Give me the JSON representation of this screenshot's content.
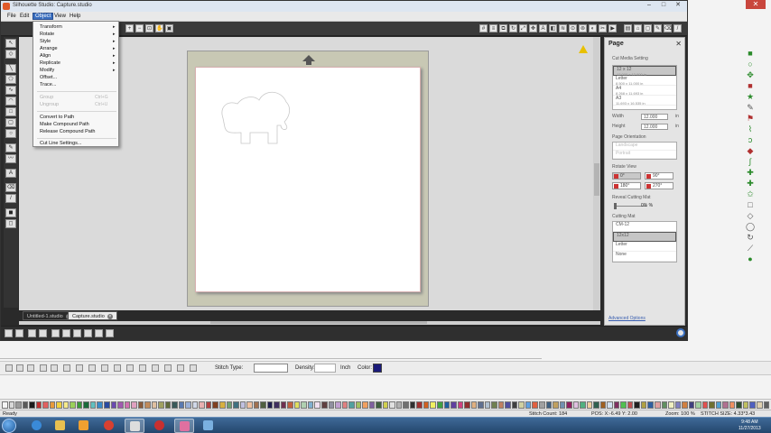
{
  "window": {
    "title": "Silhouette Studio: Capture.studio"
  },
  "menubar": {
    "file": "File",
    "edit": "Edit",
    "object": "Object",
    "view": "View",
    "help": "Help"
  },
  "object_menu": {
    "transform": "Transform",
    "rotate": "Rotate",
    "style": "Style",
    "arrange": "Arrange",
    "align": "Align",
    "replicate": "Replicate",
    "modify": "Modify",
    "offset": "Offset...",
    "trace": "Trace...",
    "group": "Group",
    "group_shortcut": "Ctrl+G",
    "ungroup": "Ungroup",
    "ungroup_shortcut": "Ctrl+U",
    "convert_to_path": "Convert to Path",
    "make_compound_path": "Make Compound Path",
    "release_compound_path": "Release Compound Path",
    "cut_line_settings": "Cut Line Settings..."
  },
  "doc_tabs": {
    "tab1": "Untitled-1.studio",
    "tab2": "Capture.studio"
  },
  "page_panel": {
    "title": "Page",
    "section_setting": "Cut Media Setting",
    "sizes": [
      {
        "name": "12 x 12",
        "dims": "12.000 x 12.000 in"
      },
      {
        "name": "Letter",
        "dims": "8.500 x 11.000 in"
      },
      {
        "name": "A4",
        "dims": "8.268 x 11.693 in"
      },
      {
        "name": "A3",
        "dims": "11.693 x 16.535 in"
      }
    ],
    "width_label": "Width",
    "width_value": "12.000",
    "width_unit": "in",
    "height_label": "Height",
    "height_value": "12.000",
    "height_unit": "in",
    "orientation_label": "Page Orientation",
    "orientation_options": [
      "Landscape",
      "Portrait"
    ],
    "rotate_label": "Rotate View",
    "rotate_options": [
      "0°",
      "90°",
      "180°",
      "270°"
    ],
    "reveal_label": "Reveal Cutting Mat",
    "reveal_value": "0%",
    "reveal_percent": "%",
    "mat_label": "Cutting Mat",
    "mat_options": [
      "CM-12",
      "12x12",
      "Letter",
      "None"
    ],
    "advanced": "Advanced Options"
  },
  "bg_app": {
    "stitch_type_label": "Stitch Type:",
    "density_label": "Density:",
    "inch_label": "Inch",
    "color_label": "Color:",
    "status_ready": "Ready",
    "status_stitch_count": "Stitch Count: 184",
    "status_pos": "POS: X:-6.49   Y: 2.00",
    "status_zoom": "Zoom: 100 %",
    "status_size": "STITCH SIZE: 4.33*3.43"
  },
  "taskbar": {
    "time": "9:48 AM",
    "date": "11/27/2013"
  },
  "colors": {
    "palette": [
      "#f4f4f4",
      "#d8d8d8",
      "#9a9a9a",
      "#5a5a5a",
      "#1c1c1c",
      "#c03030",
      "#e06060",
      "#e89a3a",
      "#f0d040",
      "#f6ea8a",
      "#9ad05a",
      "#3a9a3a",
      "#1a6a3a",
      "#60c0c0",
      "#3a8ac8",
      "#2a4aa0",
      "#6a4ab0",
      "#a05ab0",
      "#d070b0",
      "#e0a0c0",
      "#8a5a3a",
      "#c08a5a",
      "#e0c0a0",
      "#a0a060",
      "#606a3a",
      "#3a5a5a",
      "#5a7ab0",
      "#9ab0d8",
      "#d0d8e8",
      "#e8b0b0",
      "#b04040",
      "#804020",
      "#d8b040",
      "#70a070",
      "#407080",
      "#c0c0e0",
      "#f0c0a0",
      "#a07050",
      "#506040",
      "#202050",
      "#403060",
      "#703050",
      "#c06040",
      "#e0e060",
      "#b0d0b0",
      "#80b0d0",
      "#f0e0f0",
      "#604040",
      "#9090a0",
      "#c0a0d0",
      "#e08080",
      "#50a0a0",
      "#a0c060",
      "#f0a060",
      "#8060a0",
      "#406040",
      "#d0d050",
      "#e0e0e0",
      "#b0b0b0",
      "#707070",
      "#303030",
      "#a03030",
      "#d06020",
      "#f0f060",
      "#40a040",
      "#2060a0",
      "#6040a0",
      "#d04080",
      "#903030",
      "#e0b080",
      "#607090",
      "#b0c0d0",
      "#708050",
      "#c08060",
      "#5050a0",
      "#404040",
      "#d0d0a0",
      "#60a0e0",
      "#e06040",
      "#a0a0a0",
      "#406080",
      "#c0a060",
      "#7090b0",
      "#902060",
      "#e0c0e0",
      "#50b080",
      "#f0d0a0",
      "#306050",
      "#a06020",
      "#d0e0f0",
      "#803060",
      "#50c050",
      "#c05050",
      "#202020",
      "#b0a040",
      "#3060a0",
      "#e0a0a0",
      "#609060",
      "#f0f0c0",
      "#8080c0",
      "#d08040",
      "#404080",
      "#a0d0a0",
      "#e05050",
      "#707030",
      "#50a0d0",
      "#b07090",
      "#f09060",
      "#305030",
      "#c0c060",
      "#5060c0",
      "#e0d0b0",
      "#606060"
    ]
  }
}
